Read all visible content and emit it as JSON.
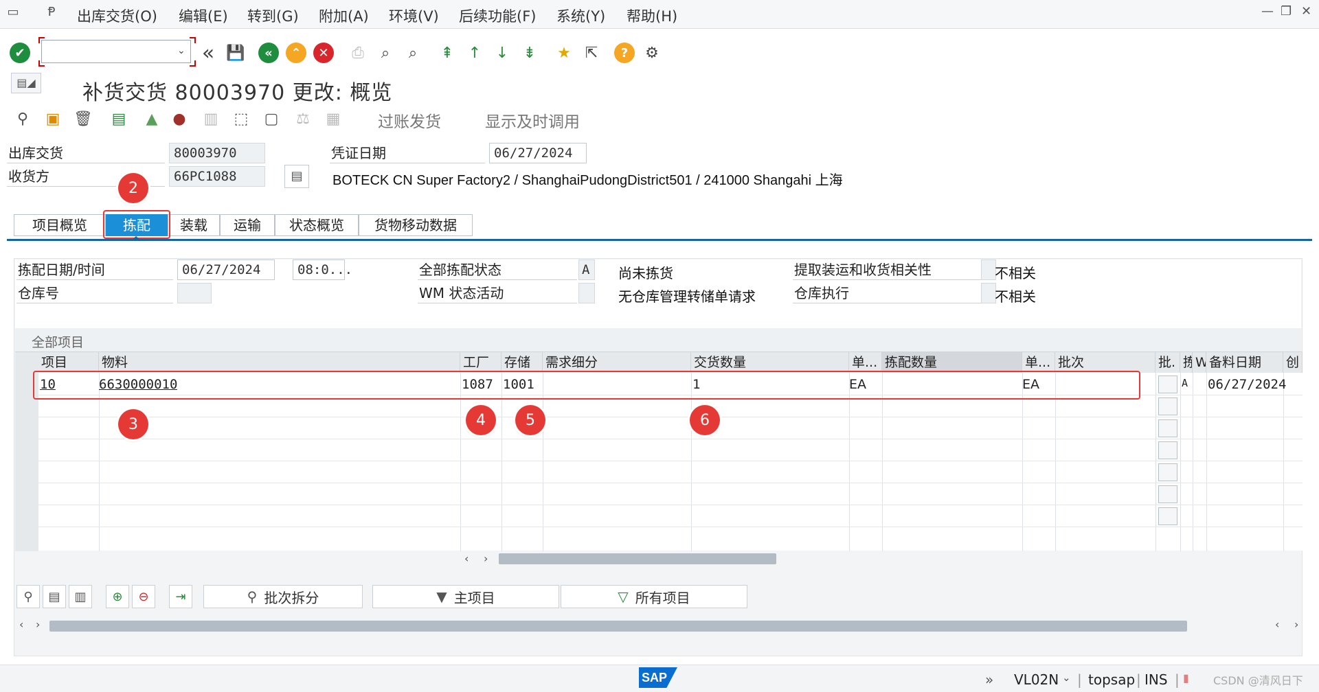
{
  "menubar": {
    "items": [
      "出库交货(O)",
      "编辑(E)",
      "转到(G)",
      "附加(A)",
      "环境(V)",
      "后续功能(F)",
      "系统(Y)",
      "帮助(H)"
    ]
  },
  "toolbar": {
    "command_value": ""
  },
  "page": {
    "title": "补货交货 80003970 更改: 概览"
  },
  "app_toolbar": {
    "post_goods_issue": "过账发货",
    "display_timely": "显示及时调用"
  },
  "header": {
    "outbound_label": "出库交货",
    "outbound_value": "80003970",
    "receiver_label": "收货方",
    "receiver_value": "66PC1088",
    "doc_date_label": "凭证日期",
    "doc_date_value": "06/27/2024",
    "receiver_desc": "BOTECK CN Super Factory2 / ShanghaiPudongDistrict501 / 241000 Shangahi 上海"
  },
  "tabs": [
    "项目概览",
    "拣配",
    "装载",
    "运输",
    "状态概览",
    "货物移动数据"
  ],
  "active_tab": "拣配",
  "picking": {
    "pick_date_label": "拣配日期/时间",
    "pick_date_value": "06/27/2024",
    "pick_time_value": "08:0...",
    "warehouse_label": "仓库号",
    "warehouse_value": "",
    "overall_status_label": "全部拣配状态",
    "overall_status_value": "A",
    "overall_status_text": "尚未拣货",
    "wm_status_label": "WM 状态活动",
    "wm_status_value": "",
    "wm_status_text": "无仓库管理转储单请求",
    "relevance_label": "提取装运和收货相关性",
    "relevance_value": "不相关",
    "wh_exec_label": "仓库执行",
    "wh_exec_value": "不相关"
  },
  "items_table": {
    "title": "全部项目",
    "columns": [
      "项目",
      "物料",
      "工厂",
      "存储",
      "需求细分",
      "交货数量",
      "单...",
      "拣配数量",
      "单...",
      "批次",
      "批.",
      "拣",
      "W",
      "备料日期",
      "创"
    ],
    "rows": [
      {
        "item": "10",
        "material": "6630000010",
        "plant": "1087",
        "storage": "1001",
        "req_seg": "",
        "deliv_qty": "1",
        "unit1": "EA",
        "pick_qty": "",
        "unit2": "EA",
        "batch": "",
        "pick_status": "A",
        "avail_date": "06/27/2024"
      }
    ]
  },
  "annotations": [
    "2",
    "3",
    "4",
    "5",
    "6"
  ],
  "bottom_buttons": {
    "batch_split": "批次拆分",
    "main_items": "主项目",
    "all_items": "所有项目"
  },
  "statusbar": {
    "tcode": "VL02N",
    "server": "topsap",
    "mode": "INS",
    "sap_logo": "SAP",
    "watermark": "CSDN @清风日下"
  },
  "colors": {
    "accent": "#1b8fd8",
    "annotation_red": "#e53935",
    "confirm_green": "#1e8e3e",
    "help_orange": "#f5a623"
  }
}
